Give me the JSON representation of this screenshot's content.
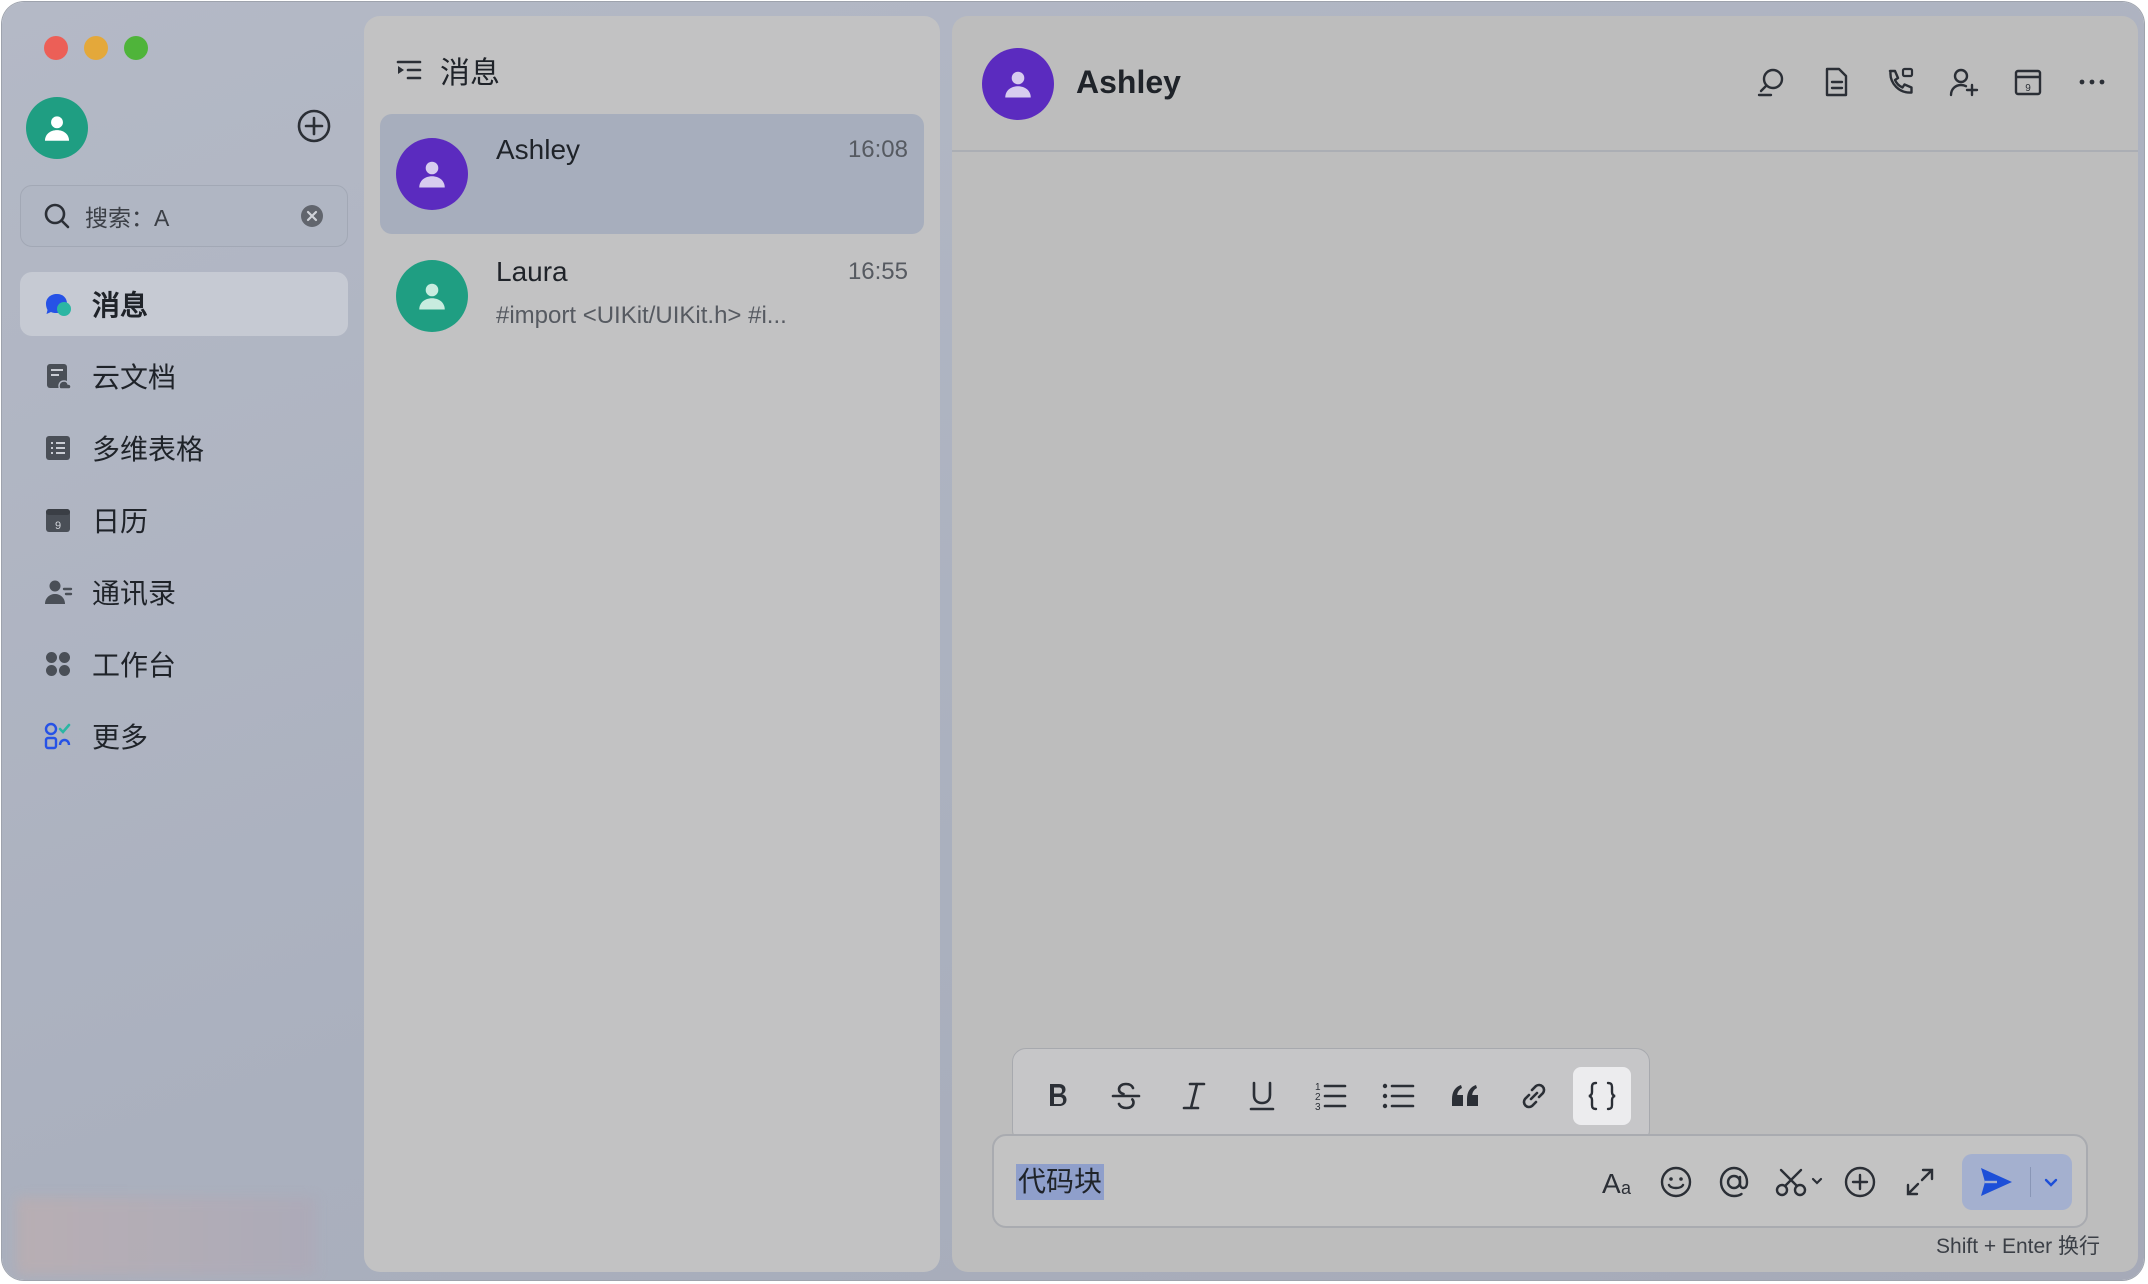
{
  "window": {
    "traffic_lights": [
      "close",
      "minimize",
      "zoom"
    ]
  },
  "sidebar": {
    "search": {
      "value": "搜索：A"
    },
    "items": [
      {
        "label": "消息",
        "icon": "chat-bubble-icon",
        "active": true
      },
      {
        "label": "云文档",
        "icon": "cloud-doc-icon"
      },
      {
        "label": "多维表格",
        "icon": "table-icon"
      },
      {
        "label": "日历",
        "icon": "calendar-icon"
      },
      {
        "label": "通讯录",
        "icon": "contacts-icon"
      },
      {
        "label": "工作台",
        "icon": "workspace-icon"
      },
      {
        "label": "更多",
        "icon": "more-apps-icon"
      }
    ]
  },
  "chat_list": {
    "title": "消息",
    "chats": [
      {
        "name": "Ashley",
        "time": "16:08",
        "preview": "",
        "avatar_color": "#5b2bbf",
        "selected": true
      },
      {
        "name": "Laura",
        "time": "16:55",
        "preview": "#import <UIKit/UIKit.h> #i...",
        "avatar_color": "#1f9e82",
        "selected": false
      }
    ]
  },
  "conversation": {
    "name": "Ashley",
    "header_icons": [
      "search-chat-icon",
      "document-icon",
      "call-icon",
      "add-member-icon",
      "calendar-icon",
      "more-icon"
    ],
    "format_toolbar": [
      "bold",
      "strikethrough",
      "italic",
      "underline",
      "ordered-list",
      "bullet-list",
      "quote",
      "link",
      "code-block"
    ],
    "input_value": "代码块",
    "hint": "Shift + Enter 换行"
  },
  "colors": {
    "accent": "#1d4fd8",
    "selected_row": "#a7aebd",
    "me_avatar": "#1f9e82"
  }
}
